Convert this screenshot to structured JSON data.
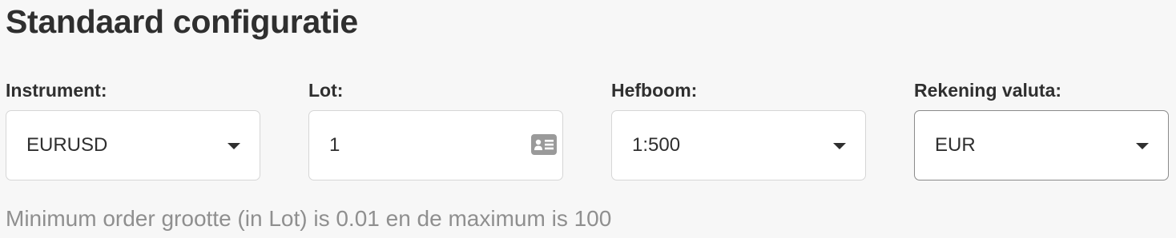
{
  "page": {
    "title": "Standaard configuratie"
  },
  "fields": {
    "instrument": {
      "label": "Instrument:",
      "value": "EURUSD",
      "icon": "chevron-down-icon"
    },
    "lot": {
      "label": "Lot:",
      "value": "1",
      "icon": "id-card-icon"
    },
    "leverage": {
      "label": "Hefboom:",
      "value": "1:500",
      "icon": "chevron-down-icon"
    },
    "currency": {
      "label": "Rekening valuta:",
      "value": "EUR",
      "icon": "chevron-down-icon"
    }
  },
  "hint": "Minimum order grootte (in Lot) is 0.01 en de maximum is 100",
  "colors": {
    "background": "#f7f7f7",
    "text": "#2f2f2f",
    "hint_text": "#8f8f8f",
    "border": "#d6d6d6",
    "border_active": "#8a8a8a",
    "icon": "#9a9a9a"
  }
}
